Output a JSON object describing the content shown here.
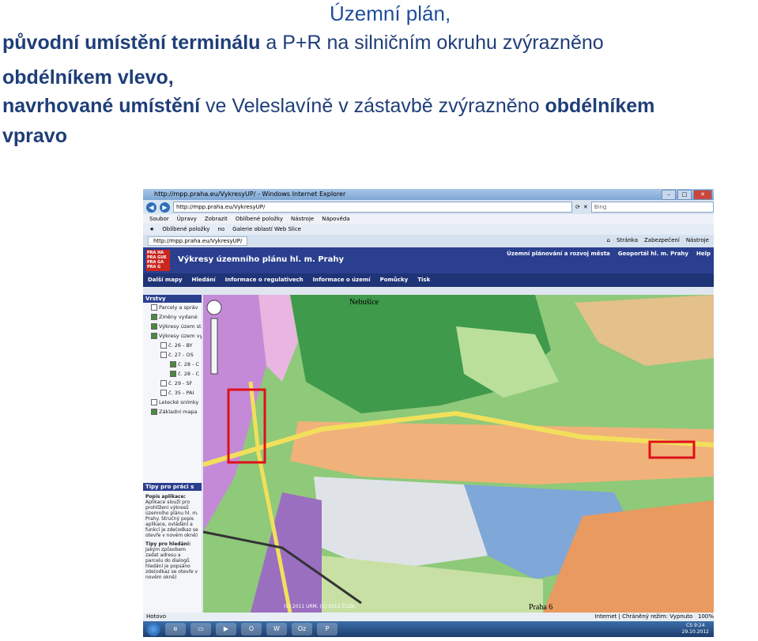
{
  "slide": {
    "line1": "Územní plán,",
    "line2_bold": "původní umístění terminálu",
    "line2_rest": " a P+R na silničním okruhu zvýrazněno",
    "line3": "obdélníkem vlevo,",
    "line4_bold": "navrhované umístění",
    "line4_mid": " ve Veleslavíně v zástavbě zvýrazněno ",
    "line4_bold2": "obdélníkem",
    "line5": "vpravo"
  },
  "browser": {
    "window_title": "http://mpp.praha.eu/VykresyUP/ - Windows Internet Explorer",
    "address": "http://mpp.praha.eu/VykresyUP/",
    "search_placeholder": "Bing",
    "menu": [
      "Soubor",
      "Úpravy",
      "Zobrazit",
      "Oblíbené položky",
      "Nástroje",
      "Nápověda"
    ],
    "favorites": [
      "Oblíbené položky",
      "no",
      "Galerie oblastí Web Slice"
    ],
    "tab_label": "http://mpp.praha.eu/VykresyUP/",
    "tab_tools": [
      "Stránka",
      "Zabezpečení",
      "Nástroje"
    ],
    "status_left": "Hotovo",
    "status_right": "Internet | Chráněný režim: Vypnuto",
    "zoom": "100%"
  },
  "page": {
    "logo": [
      "PRA HA",
      "PRA GUE",
      "PRA GA",
      "PRA G"
    ],
    "title": "Výkresy územního plánu hl. m. Prahy",
    "header_links": [
      "Územní plánování a rozvoj města",
      "Geoportál hl. m. Prahy",
      "Help"
    ],
    "app_menu": [
      "Další mapy",
      "Hledání",
      "Informace o regulativech",
      "Informace o území",
      "Pomůcky",
      "Tisk"
    ]
  },
  "sidebar": {
    "heading": "Vrstvy",
    "items": [
      {
        "label": "Parcely a správ",
        "level": 1
      },
      {
        "label": "Změny vydané",
        "level": 1
      },
      {
        "label": "Výkresy územ stav k 21.6.20",
        "level": 1
      },
      {
        "label": "Výkresy územ vydané výkres aktualizovány",
        "level": 1
      },
      {
        "label": "č. 26 - BY",
        "level": 2
      },
      {
        "label": "č. 27 - OS",
        "level": 2
      },
      {
        "label": "č. 28 - C",
        "level": 3
      },
      {
        "label": "č. 28 - C",
        "level": 3
      },
      {
        "label": "č. 29 - SF",
        "level": 2
      },
      {
        "label": "č. 35 - PAI",
        "level": 2
      },
      {
        "label": "Letecké snímky",
        "level": 1
      },
      {
        "label": "Základní mapa",
        "level": 1
      }
    ],
    "help_heading": "Tipy pro práci s",
    "help_title1": "Popis aplikace:",
    "help_text1": "Aplikace slouží pro prohlížení výkresů územního plánu hl. m. Prahy. Stručný popis aplikace, ovládání a funkcí je zde(odkaz se otevře v novém okně)",
    "help_title2": "Tipy pro hledání:",
    "help_text2": "Jakým způsobem zadat adresu a parcelu do dialogů hledání je popsáno zde(odkaz se otevře v novém okně)"
  },
  "map": {
    "label_top": "Nebušice",
    "label_bottom": "Praha 6",
    "copyright": "(C) 2011 URM, (C) 2011 ČÚZK",
    "highlight_color": "#e0101a"
  },
  "taskbar": {
    "lang": "CS",
    "time": "9:24",
    "date": "29.10.2012"
  }
}
